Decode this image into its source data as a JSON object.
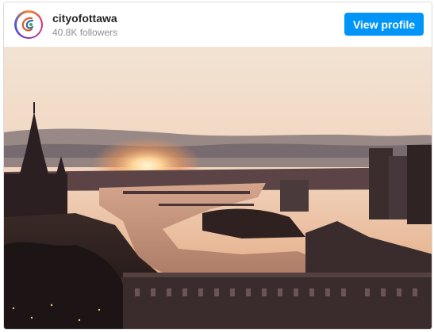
{
  "post": {
    "username": "cityofottawa",
    "followers": "40.8K followers",
    "view_profile_label": "View profile",
    "avatar_icon": "city-of-ottawa-logo",
    "photo_description": "sunset over Ottawa river"
  },
  "colors": {
    "button": "#0095f6",
    "username": "#262626",
    "muted": "#8e8e8e"
  }
}
